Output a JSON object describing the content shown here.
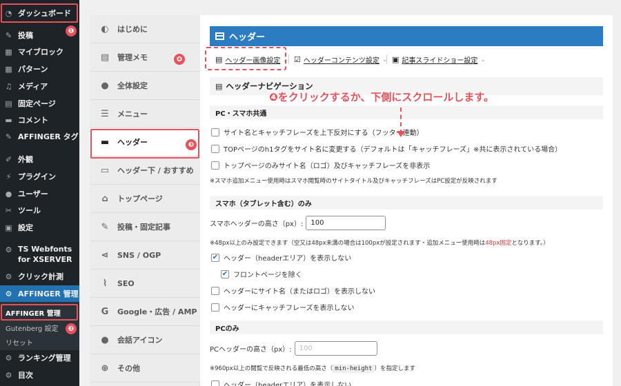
{
  "wp_sidebar": {
    "items": [
      {
        "label": "ダッシュボード",
        "icon": "gauge-icon"
      },
      {
        "label": "投稿",
        "icon": "pin-icon"
      },
      {
        "label": "マイブロック",
        "icon": "grid-icon"
      },
      {
        "label": "パターン",
        "icon": "grid-icon"
      },
      {
        "label": "メディア",
        "icon": "media-icon"
      },
      {
        "label": "固定ページ",
        "icon": "page-icon"
      },
      {
        "label": "コメント",
        "icon": "comment-icon"
      },
      {
        "label": "AFFINGER タグ",
        "icon": "pin-icon"
      },
      {
        "label": "外観",
        "icon": "brush-icon"
      },
      {
        "label": "プラグイン",
        "icon": "plugin-icon"
      },
      {
        "label": "ユーザー",
        "icon": "user-icon"
      },
      {
        "label": "ツール",
        "icon": "wrench-icon"
      },
      {
        "label": "設定",
        "icon": "settings-icon"
      },
      {
        "label": "TS Webfonts for XSERVER",
        "icon": "gear-icon"
      },
      {
        "label": "クリック計測",
        "icon": "gear-icon"
      },
      {
        "label": "AFFINGER 管理",
        "icon": "gear-icon"
      },
      {
        "label": "ランキング管理",
        "icon": "gear-icon"
      },
      {
        "label": "目次",
        "icon": "gear-icon"
      }
    ],
    "submenu": [
      "AFFINGER 管理",
      "Gutenberg 設定",
      "リセット"
    ]
  },
  "badges": [
    "❶",
    "❷",
    "❸",
    "❹"
  ],
  "aff_nav": {
    "items": [
      {
        "label": "はじめに",
        "icon": "shield-icon",
        "glyph": "◐"
      },
      {
        "label": "管理メモ",
        "icon": "document-icon",
        "glyph": "▤"
      },
      {
        "label": "全体設定",
        "icon": "palette-icon",
        "glyph": "●"
      },
      {
        "label": "メニュー",
        "icon": "menu-icon",
        "glyph": "☰"
      },
      {
        "label": "ヘッダー",
        "icon": "header-layout-icon",
        "glyph": "▬"
      },
      {
        "label": "ヘッダー下 / おすすめ",
        "icon": "below-header-icon",
        "glyph": "▭"
      },
      {
        "label": "トップページ",
        "icon": "home-icon",
        "glyph": "⌂"
      },
      {
        "label": "投稿・固定記事",
        "icon": "edit-icon",
        "glyph": "✎"
      },
      {
        "label": "SNS / OGP",
        "icon": "share-icon",
        "glyph": "⋖"
      },
      {
        "label": "SEO",
        "icon": "chart-icon",
        "glyph": "⌇"
      },
      {
        "label": "Google・広告 / AMP",
        "icon": "google-icon",
        "glyph": "G"
      },
      {
        "label": "会話アイコン",
        "icon": "speech-icon",
        "glyph": "●"
      },
      {
        "label": "その他",
        "icon": "plus-circle-icon",
        "glyph": "⊕"
      }
    ]
  },
  "main": {
    "title": "ヘッダー",
    "tabs": [
      {
        "label": "ヘッダー画像設定",
        "icon": "▤"
      },
      {
        "label": "ヘッダーコンテンツ設定",
        "icon": "☑"
      },
      {
        "label": "記事スライドショー設定",
        "icon": "▣"
      }
    ],
    "nav_section_title": "ヘッダーナビゲーション",
    "annotation": "❹をクリックするか、下側にスクロールします。",
    "pc_sp_common": {
      "heading": "PC・スマホ共通",
      "options": [
        "サイト名とキャッチフレーズを上下反対にする（フッター連動）",
        "TOPページのh1タグをサイト名に変更する（デフォルトは「キャッチフレーズ」※共に表示されている場合）",
        "トップページのみサイト名（ロゴ）及びキャッチフレーズを非表示"
      ],
      "note": "※スマホ追加メニュー使用時はスマホ閲覧時のサイトタイトル及びキャッチフレーズはPC設定が反映されます"
    },
    "sp_only": {
      "heading": "スマホ（タブレット含む）のみ",
      "height_label": "スマホヘッダーの高さ（px）:",
      "height_value": "100",
      "note_pre": "※48px以上のみ設定できます（空又は48px未満の場合は100pxが設定されます・追加メニュー使用時は",
      "note_red": "48px固定",
      "note_post": "となります。）",
      "options": [
        {
          "label": "ヘッダー（headerエリア）を表示しない",
          "checked": true
        },
        {
          "label": "フロントページを除く",
          "checked": true
        },
        {
          "label": "ヘッダーにサイト名（またはロゴ）を表示しない",
          "checked": false
        },
        {
          "label": "ヘッダーにキャッチフレーズを表示しない",
          "checked": false
        }
      ]
    },
    "pc_only": {
      "heading": "PCのみ",
      "height_label": "PCヘッダーの高さ（px）:",
      "height_placeholder": "100",
      "note_pre": "※960px以上の閲覧で反映される最低の高さ（",
      "note_code": "min-height",
      "note_post": "）を指定します",
      "options": [
        {
          "label": "ヘッダー（headerエリア）を表示しない",
          "checked": false
        }
      ]
    }
  },
  "colors": {
    "accent_red": "#e8505b",
    "wp_blue": "#2271b1",
    "panel_blue": "#2b7cc1"
  }
}
